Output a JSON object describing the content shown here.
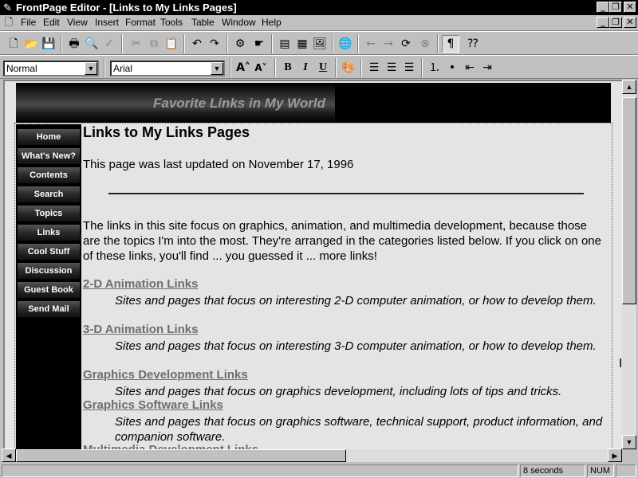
{
  "window": {
    "title": "FrontPage Editor - [Links to My Links Pages]",
    "app_icon": "frontpage-icon"
  },
  "menu": [
    "File",
    "Edit",
    "View",
    "Insert",
    "Format",
    "Tools",
    "Table",
    "Window",
    "Help"
  ],
  "toolbar": {
    "style_value": "Normal",
    "font_value": "Arial"
  },
  "banner": {
    "title": "Favorite Links in My World"
  },
  "nav": [
    "Home",
    "What's New?",
    "Contents",
    "Search",
    "Topics",
    "Links",
    "Cool Stuff",
    "Discussion",
    "Guest Book",
    "Send Mail"
  ],
  "page": {
    "title": "Links to My Links Pages",
    "updated": "This page was last updated on November 17, 1996",
    "intro": "The links in this site focus on graphics, animation, and multimedia development, because those are the topics I'm into the most. They're arranged in the categories listed below. If you click on one of these links, you'll find ... you guessed it ... more links!",
    "links": [
      {
        "title": "2-D Animation Links",
        "desc": "Sites and pages that focus on interesting 2-D computer animation, or how to develop them."
      },
      {
        "title": "3-D Animation Links",
        "desc": "Sites and pages that focus on interesting 3-D computer animation, or how to develop them."
      },
      {
        "title": "Graphics Development Links",
        "desc": "Sites and pages that focus on graphics development, including lots of tips and tricks."
      },
      {
        "title": "Graphics Software Links",
        "desc": "Sites and pages that focus on graphics software, technical support, product information, and companion software."
      },
      {
        "title": "Multimedia Development Links",
        "desc": ""
      }
    ]
  },
  "status": {
    "load_time": "8 seconds",
    "num": "NUM"
  }
}
